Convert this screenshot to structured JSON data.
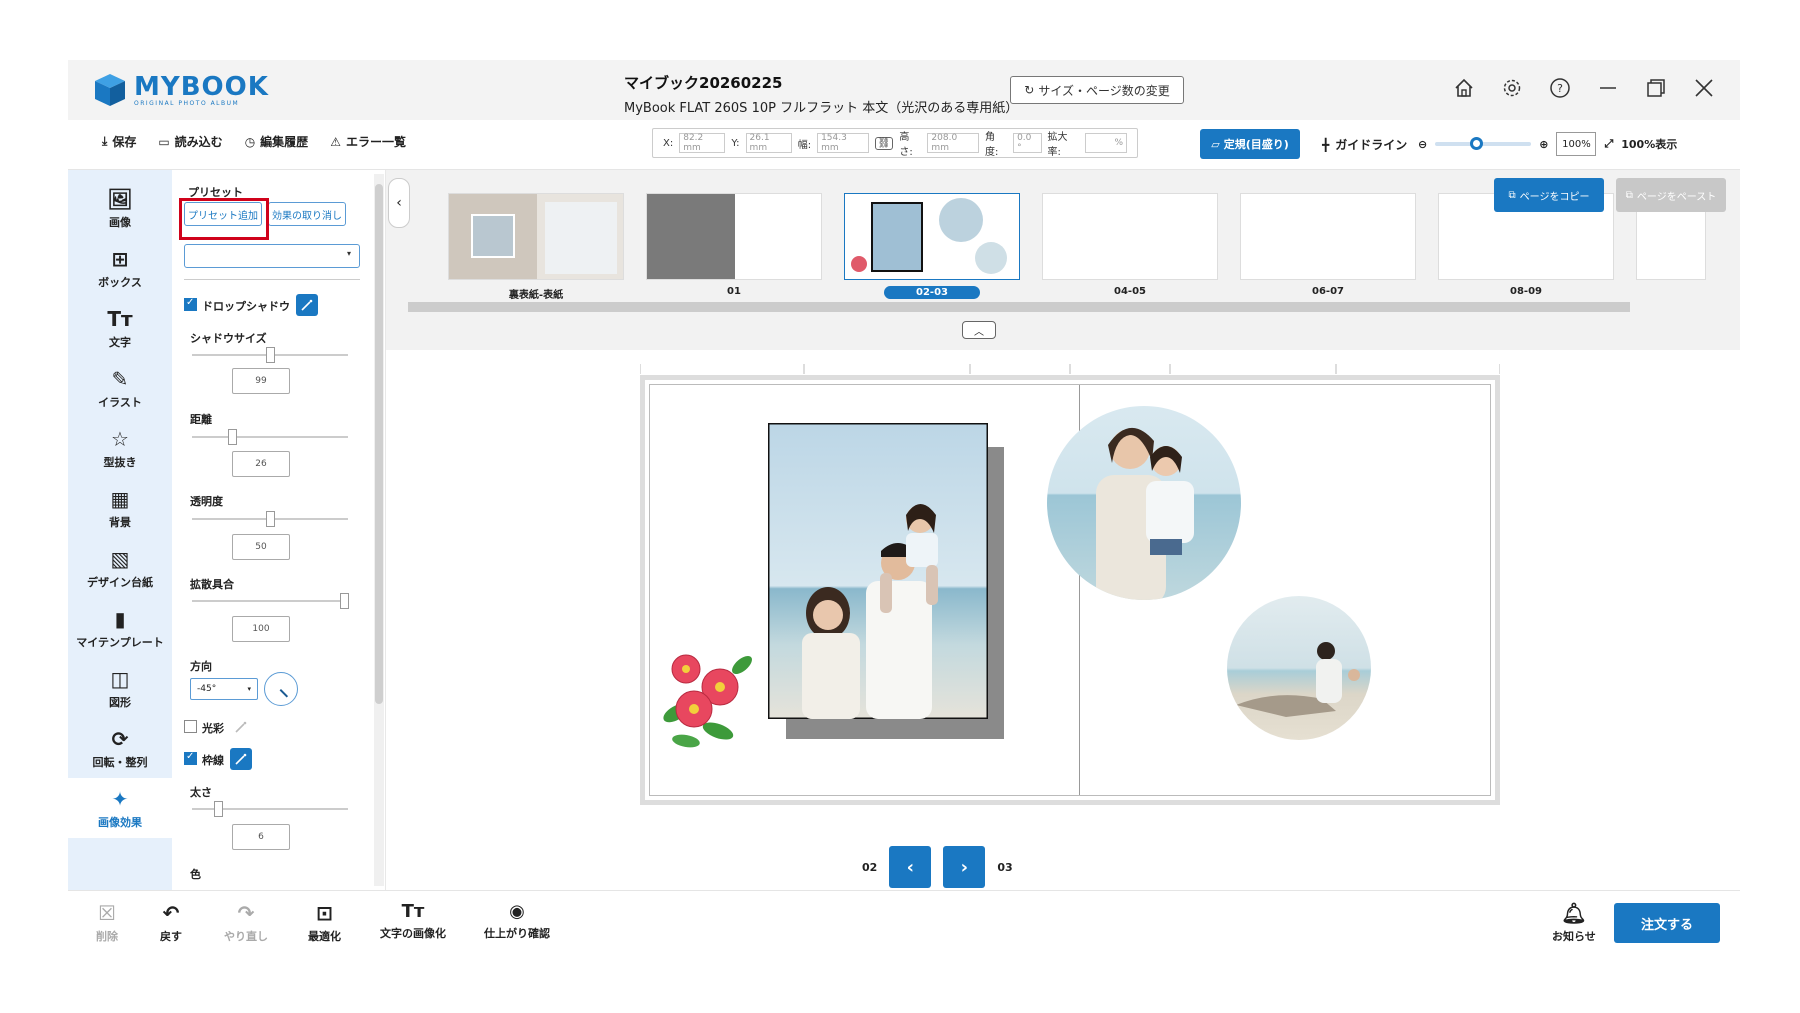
{
  "app": {
    "logo": "MYBOOK",
    "logo_sub": "ORIGINAL PHOTO ALBUM",
    "title": "マイブック20260225",
    "subtitle": "MyBook FLAT 260S 10P フルフラット 本文（光沢のある専用紙）",
    "size_change_label": "サイズ・ページ数の変更"
  },
  "toolbar": {
    "save": "保存",
    "load": "読み込む",
    "history": "編集履歴",
    "errors": "エラー一覧",
    "coords": {
      "x_label": "X:",
      "x_value": "82.2 mm",
      "y_label": "Y:",
      "y_value": "26.1 mm",
      "w_label": "幅:",
      "w_value": "154.3 mm",
      "h_label": "高さ:",
      "h_value": "208.0 mm",
      "angle_label": "角度:",
      "angle_value": "0.0 °",
      "scale_label": "拡大率:",
      "scale_value": "%"
    },
    "ruler": "定規(目盛り)",
    "guide": "ガイドライン",
    "zoom_value": "100%",
    "zoom_fraction": 0.42,
    "fit_100": "100%表示"
  },
  "rail": [
    {
      "label": "画像",
      "icon": "image-add-icon"
    },
    {
      "label": "ボックス",
      "icon": "box-icon"
    },
    {
      "label": "文字",
      "icon": "text-icon"
    },
    {
      "label": "イラスト",
      "icon": "brush-icon"
    },
    {
      "label": "型抜き",
      "icon": "star-cut-icon"
    },
    {
      "label": "背景",
      "icon": "checker-icon"
    },
    {
      "label": "デザイン台紙",
      "icon": "design-mount-icon"
    },
    {
      "label": "マイテンプレート",
      "icon": "template-icon"
    },
    {
      "label": "図形",
      "icon": "shape-icon"
    },
    {
      "label": "回転・整列",
      "icon": "rotate-icon"
    },
    {
      "label": "画像効果",
      "icon": "magic-wand-icon"
    }
  ],
  "panel": {
    "preset_title": "プリセット",
    "preset_add": "プリセット追加",
    "effect_undo": "効果の取り消し",
    "drop_shadow": "ドロップシャドウ",
    "shadow_size": "シャドウサイズ",
    "shadow_size_value": "99",
    "distance": "距離",
    "distance_value": "26",
    "opacity": "透明度",
    "opacity_value": "50",
    "blur": "拡散具合",
    "blur_value": "100",
    "direction": "方向",
    "direction_value": "-45°",
    "glow": "光彩",
    "border": "枠線",
    "thickness": "太さ",
    "thickness_value": "6",
    "color": "色"
  },
  "strip": {
    "pages": [
      "裏表紙-表紙",
      "01",
      "02-03",
      "04-05",
      "06-07",
      "08-09"
    ],
    "copy_page": "ページをコピー",
    "paste_page": "ページをペースト"
  },
  "nav": {
    "left_page": "02",
    "right_page": "03"
  },
  "bottom": {
    "delete": "削除",
    "undo": "戻す",
    "redo": "やり直し",
    "optimize": "最適化",
    "text_to_image": "文字の画像化",
    "preview": "仕上がり確認",
    "notice": "お知らせ",
    "order": "注文する"
  },
  "colors": {
    "accent": "#1a78c2",
    "highlight": "#d0021b"
  }
}
